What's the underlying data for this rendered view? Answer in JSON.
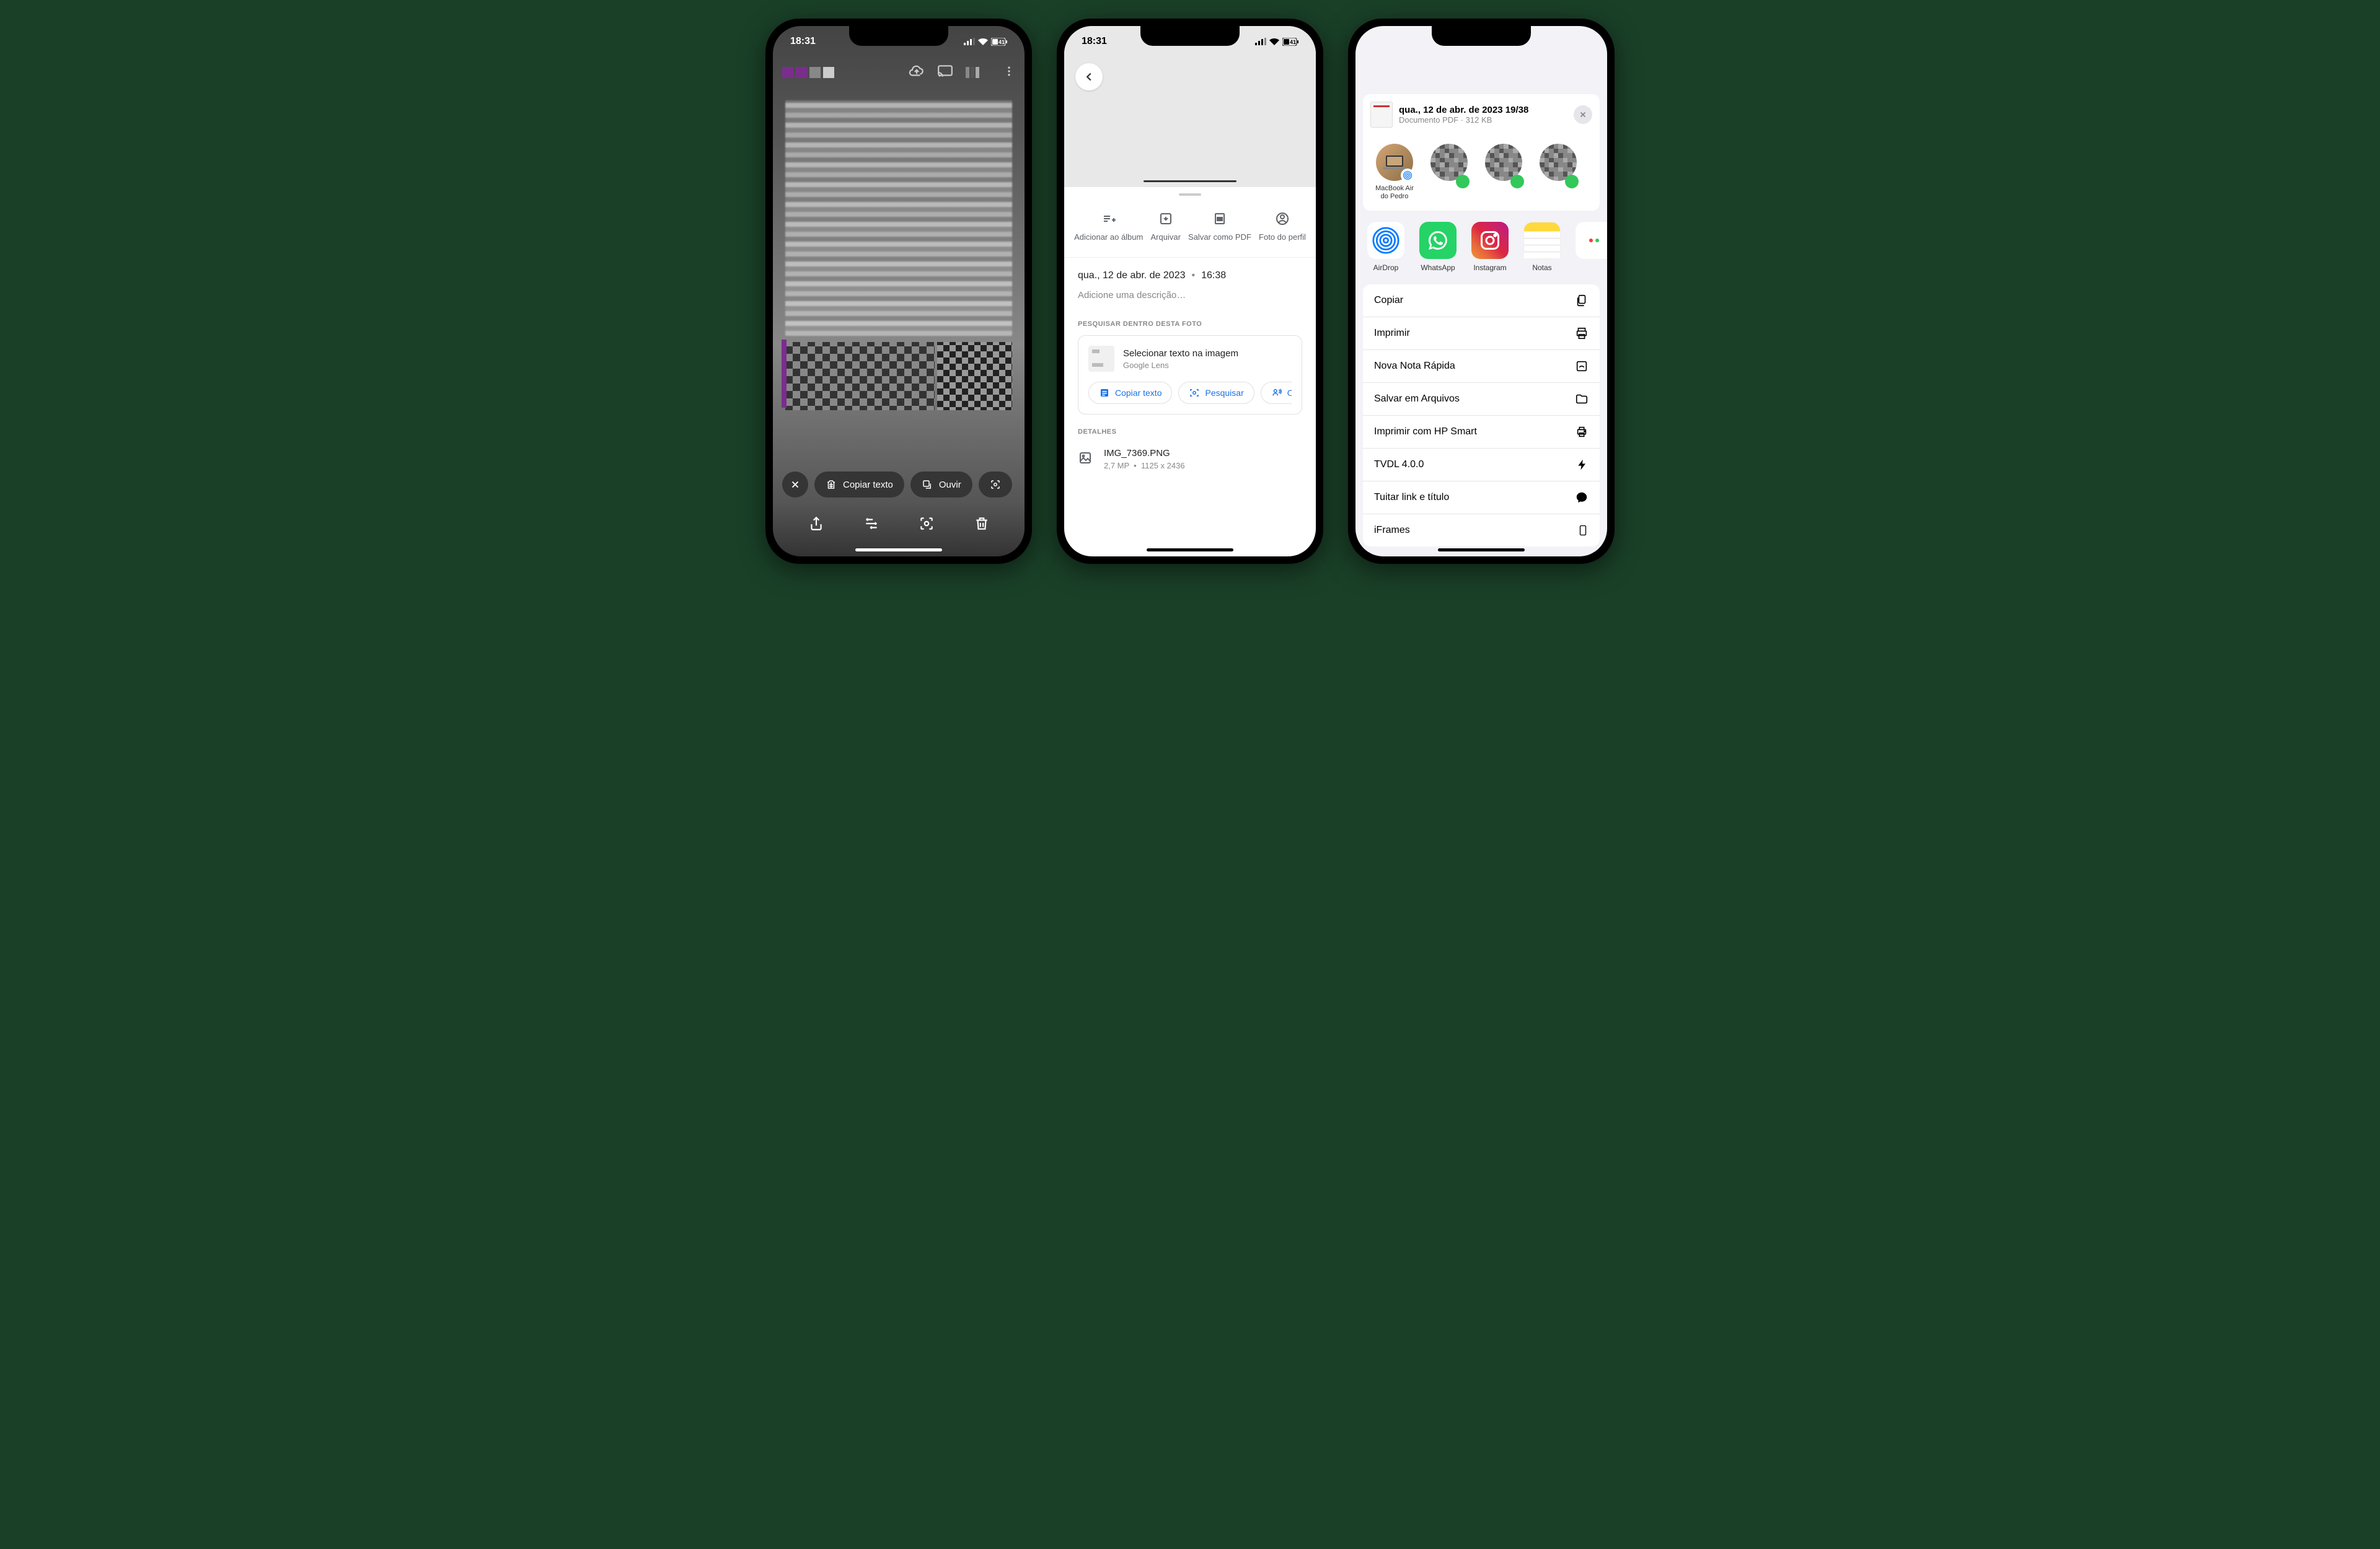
{
  "status": {
    "time": "18:31",
    "battery": "41"
  },
  "phone1": {
    "pills": {
      "copy": "Copiar texto",
      "listen": "Ouvir"
    }
  },
  "phone2": {
    "actions": {
      "add_album": "Adicionar ao álbum",
      "archive": "Arquivar",
      "save_pdf": "Salvar como PDF",
      "profile": "Foto do perfil"
    },
    "date": "qua., 12 de abr. de 2023",
    "time": "16:38",
    "desc_placeholder": "Adicione uma descrição…",
    "search_section": "PESQUISAR DENTRO DESTA FOTO",
    "lens": {
      "title": "Selecionar texto na imagem",
      "sub": "Google Lens",
      "chip_copy": "Copiar texto",
      "chip_search": "Pesquisar",
      "chip_listen": "Ou"
    },
    "details_label": "DETALHES",
    "filename": "IMG_7369.PNG",
    "filemeta_mp": "2,7 MP",
    "filemeta_dims": "1125 x 2436"
  },
  "phone3": {
    "title": "qua., 12 de abr. de 2023 19/38",
    "sub": "Documento PDF · 312 KB",
    "airdrop_mac": "MacBook Air do Pedro",
    "apps": {
      "airdrop": "AirDrop",
      "whatsapp": "WhatsApp",
      "instagram": "Instagram",
      "notes": "Notas"
    },
    "actions": {
      "copy": "Copiar",
      "print": "Imprimir",
      "quicknote": "Nova Nota Rápida",
      "savefiles": "Salvar em Arquivos",
      "hpprint": "Imprimir com HP Smart",
      "tvdl": "TVDL 4.0.0",
      "tweet": "Tuitar link e título",
      "iframes": "iFrames"
    }
  }
}
